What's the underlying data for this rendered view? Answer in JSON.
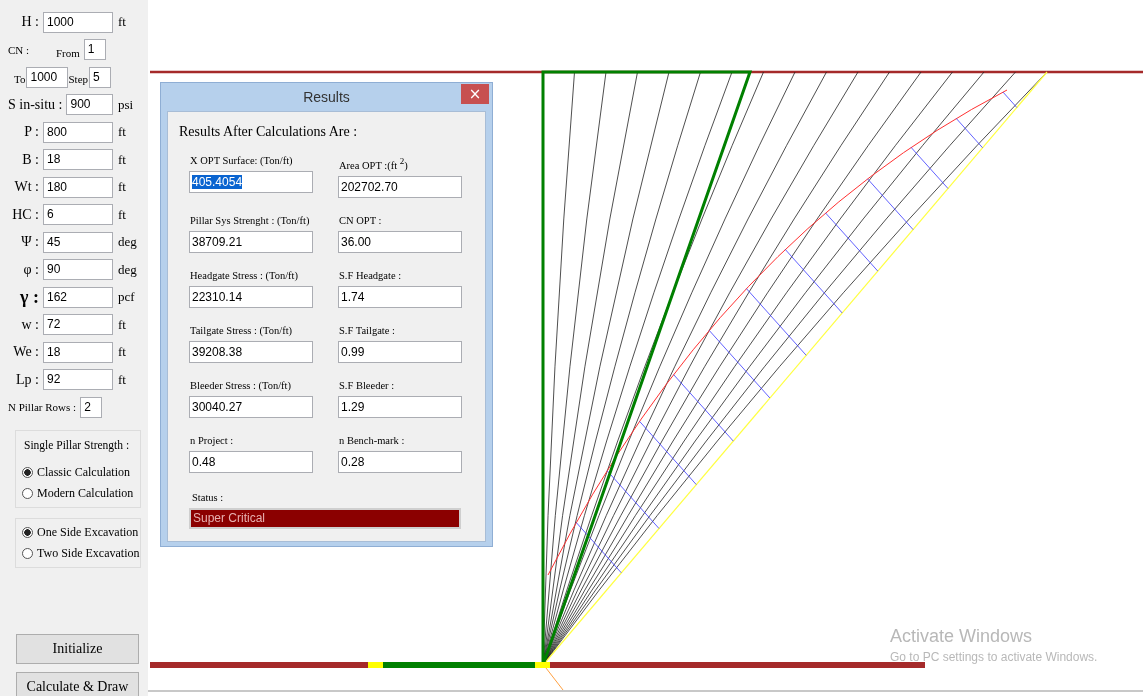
{
  "left_panel": {
    "rows": [
      {
        "kind": "field",
        "label": "H :",
        "value": "1000",
        "unit": "ft"
      },
      {
        "kind": "cn",
        "label": "CN :",
        "from_label": "From",
        "value": "1"
      },
      {
        "kind": "range",
        "to_label": "To",
        "to": "1000",
        "step_label": "Step",
        "step": "5"
      },
      {
        "kind": "field",
        "label": "S in-situ :",
        "value": "900",
        "unit": "psi"
      },
      {
        "kind": "field",
        "label": "P :",
        "value": "800",
        "unit": "ft"
      },
      {
        "kind": "field",
        "label": "B :",
        "value": "18",
        "unit": "ft"
      },
      {
        "kind": "field",
        "label": "Wt :",
        "value": "180",
        "unit": "ft"
      },
      {
        "kind": "field",
        "label": "HC :",
        "value": "6",
        "unit": "ft"
      },
      {
        "kind": "field",
        "label": "Ψ :",
        "value": "45",
        "unit": "deg"
      },
      {
        "kind": "field",
        "label": "φ :",
        "value": "90",
        "unit": "deg"
      },
      {
        "kind": "field",
        "label": "γ :",
        "value": "162",
        "unit": "pcf"
      },
      {
        "kind": "field",
        "label": "w :",
        "value": "72",
        "unit": "ft"
      },
      {
        "kind": "field",
        "label": "We :",
        "value": "18",
        "unit": "ft"
      },
      {
        "kind": "field",
        "label": "Lp :",
        "value": "92",
        "unit": "ft"
      },
      {
        "kind": "field",
        "label": "N Pillar Rows :",
        "value": "2"
      }
    ],
    "strength_group": {
      "title": "Single Pillar Strength :",
      "options": [
        {
          "label": "Classic Calculation",
          "selected": true
        },
        {
          "label": "Modern Calculation",
          "selected": false
        }
      ]
    },
    "excavation_group": {
      "options": [
        {
          "label": "One Side Excavation",
          "selected": true
        },
        {
          "label": "Two Side Excavation",
          "selected": false
        }
      ]
    },
    "buttons": [
      "Initialize",
      "Calculate & Draw"
    ]
  },
  "results_dialog": {
    "title": "Results",
    "close": "×",
    "heading": "Results After Calculations Are :",
    "fields": [
      {
        "label": "X OPT Surface: (Ton/ft)",
        "value": "405.4054",
        "highlighted": true
      },
      {
        "label": "Area OPT :(ft $^{2}$)",
        "value": "202702.70",
        "highlighted": false
      },
      {
        "label": "Pillar Sys Strenght : (Ton/ft)",
        "value": "38709.21",
        "highlighted": false
      },
      {
        "label": "CN OPT :",
        "value": "36.00",
        "highlighted": false
      },
      {
        "label": "Headgate Stress : (Ton/ft)",
        "value": "22310.14",
        "highlighted": false
      },
      {
        "label": "S.F Headgate :",
        "value": "1.74",
        "highlighted": false
      },
      {
        "label": "Tailgate Stress : (Ton/ft)",
        "value": "39208.38",
        "highlighted": false
      },
      {
        "label": "S.F Tailgate :",
        "value": "0.99",
        "highlighted": false
      },
      {
        "label": "Bleeder Stress : (Ton/ft)",
        "value": "30040.27",
        "highlighted": false
      },
      {
        "label": "S.F Bleeder :",
        "value": "1.29",
        "highlighted": false
      },
      {
        "label": "n Project :",
        "value": "0.48",
        "highlighted": false
      },
      {
        "label": "n Bench-mark :",
        "value": "0.28",
        "highlighted": false
      }
    ],
    "status": {
      "label": "Status :",
      "value": "Super Critical"
    }
  },
  "activation_notice": {
    "title": "Activate Windows",
    "subtitle": "Go to PC settings to activate Windows."
  }
}
